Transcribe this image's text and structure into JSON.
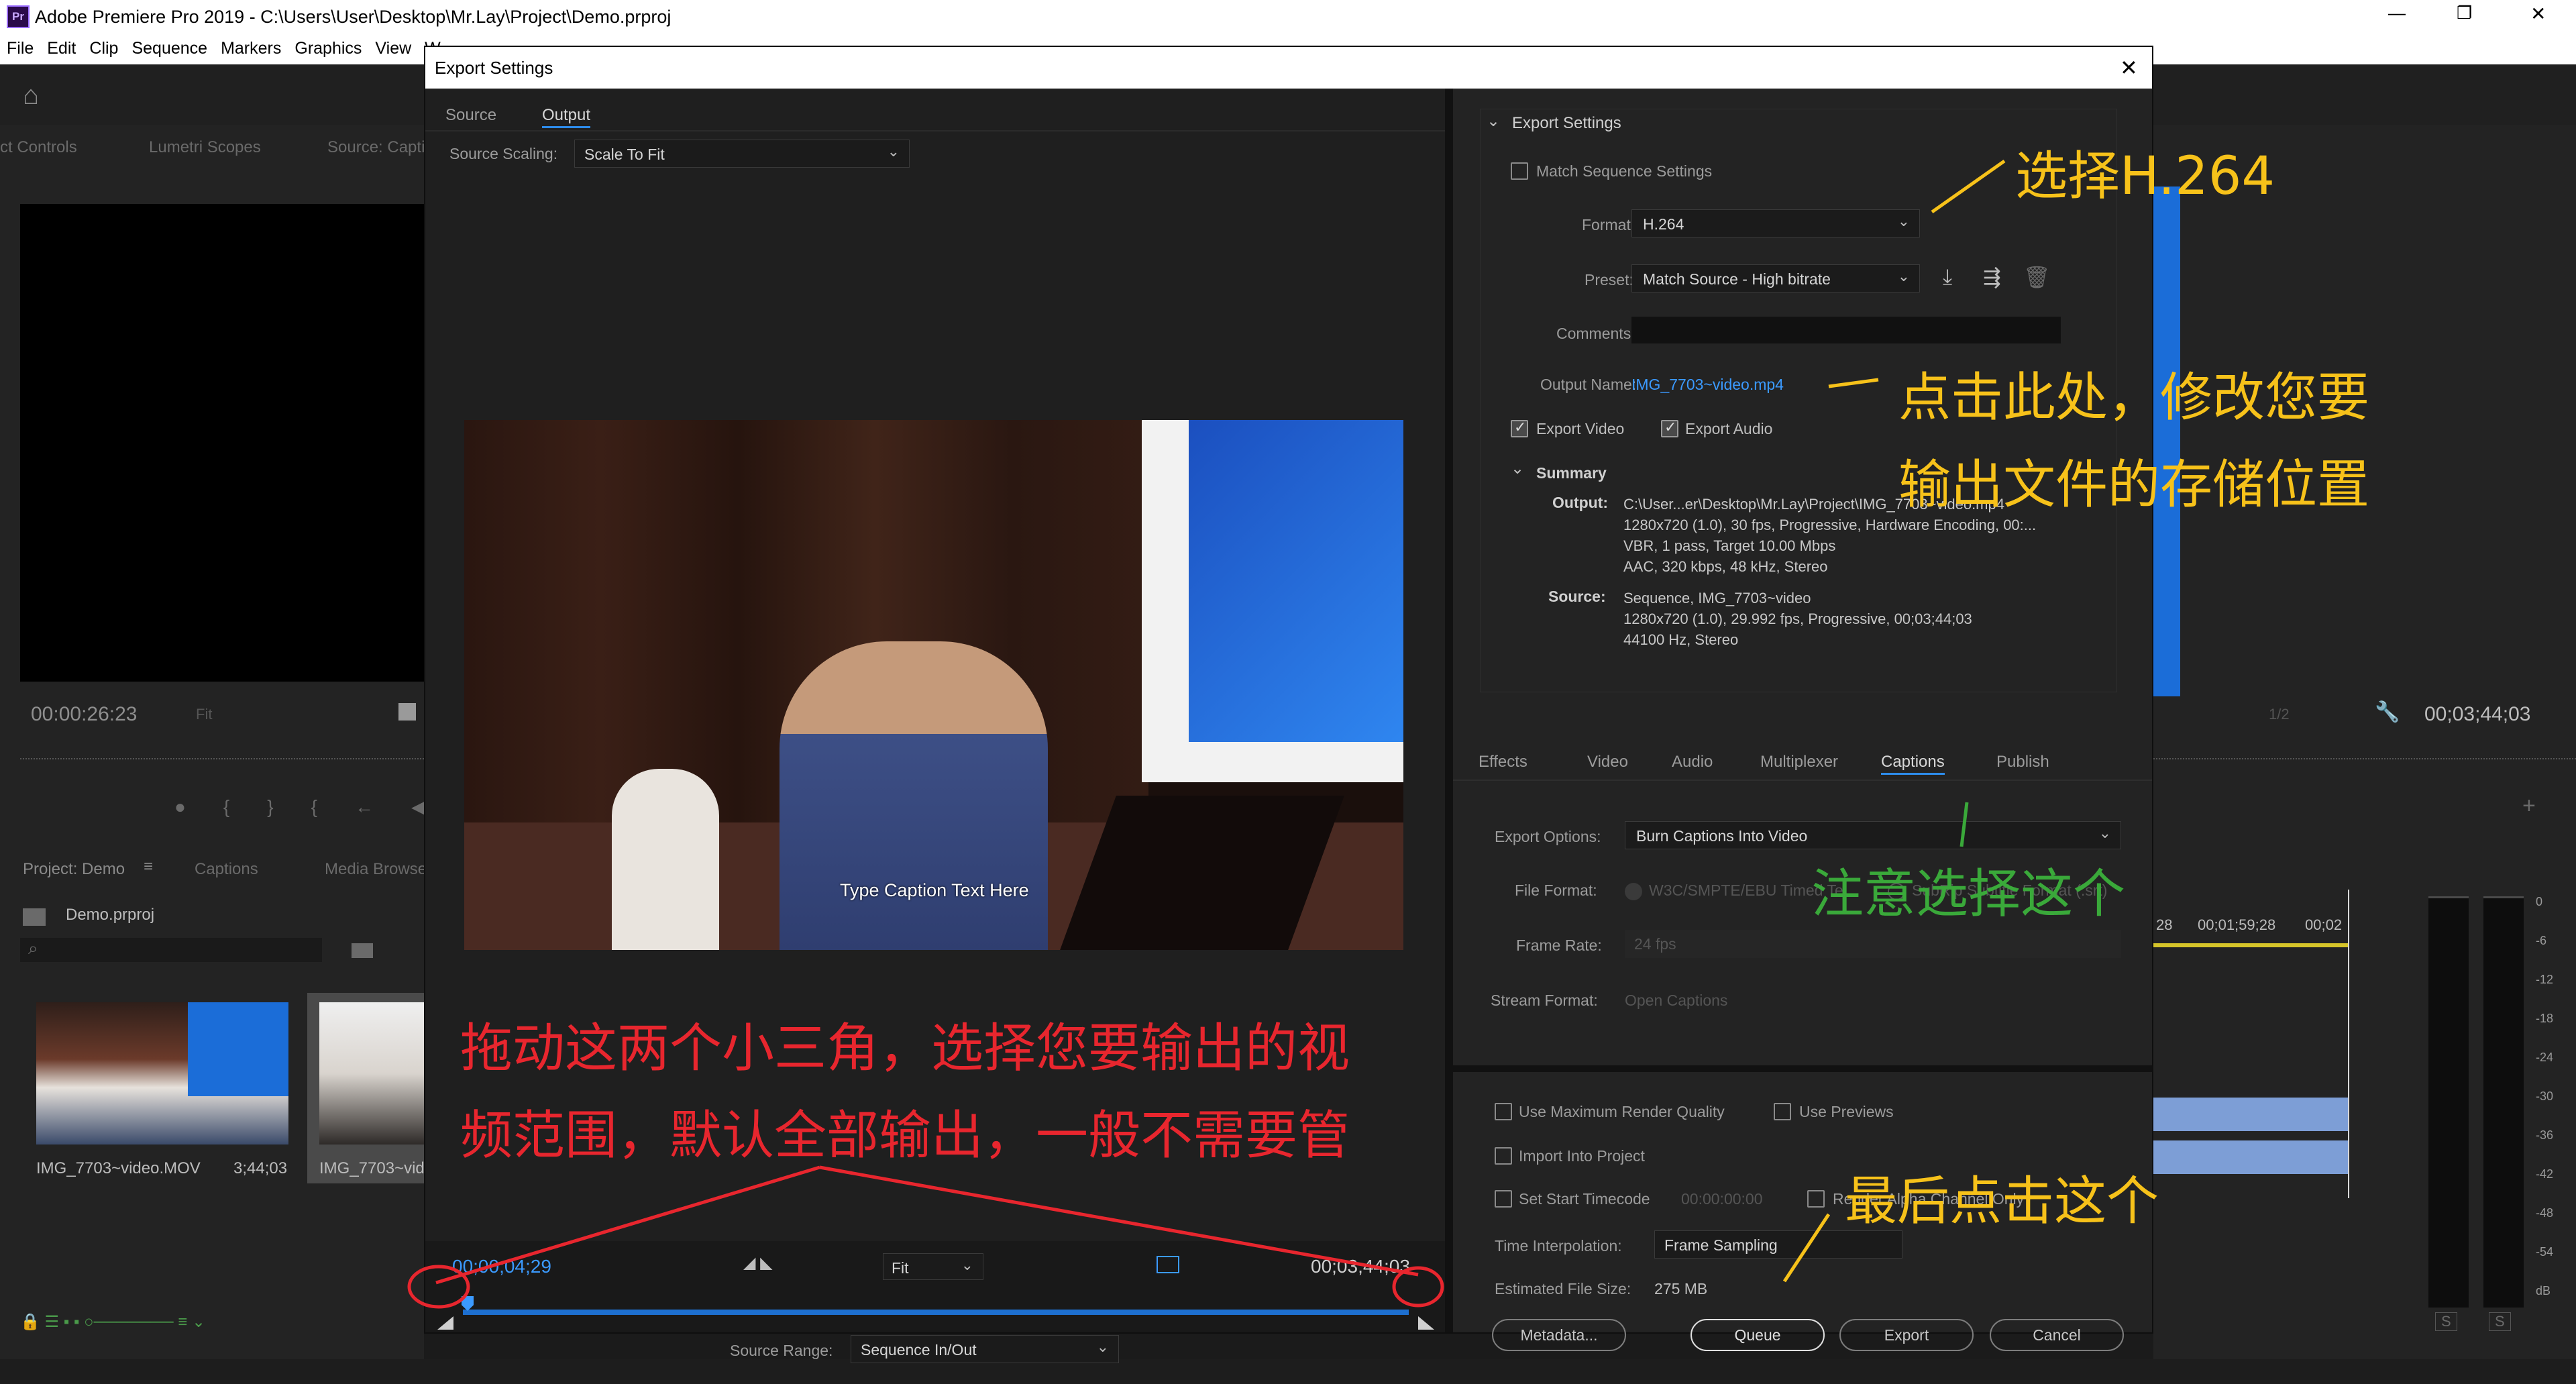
{
  "app": {
    "title": "Adobe Premiere Pro 2019 - C:\\Users\\User\\Desktop\\Mr.Lay\\Project\\Demo.prproj",
    "icon_label": "Pr",
    "window_controls": {
      "minimize": "—",
      "restore": "❐",
      "close": "✕"
    }
  },
  "menu": {
    "items": [
      "File",
      "Edit",
      "Clip",
      "Sequence",
      "Markers",
      "Graphics",
      "View",
      "W"
    ]
  },
  "left_panel": {
    "tabs": [
      "ct Controls",
      "Lumetri Scopes",
      "Source: Capti"
    ],
    "timecode": "00:00:26:23",
    "fit": "Fit",
    "transport": [
      "●",
      "{",
      "}",
      "{←",
      "◀|"
    ]
  },
  "project_panel": {
    "tabs": [
      "Project: Demo",
      "Captions",
      "Media Browse"
    ],
    "project_file": "Demo.prproj",
    "items": [
      {
        "name": "IMG_7703~video.MOV",
        "duration": "3;44;03"
      },
      {
        "name": "IMG_7703~vid",
        "duration": ""
      }
    ]
  },
  "right_side": {
    "fraction": "1/2",
    "timecode": "00;03;44;03",
    "timeline_times": [
      "28",
      "00;01;59;28",
      "00;02"
    ],
    "meter_scale": [
      "0",
      "-6",
      "-12",
      "-18",
      "-24",
      "-30",
      "-36",
      "-42",
      "-48",
      "-54",
      "dB"
    ],
    "solo": [
      "S",
      "S"
    ]
  },
  "dialog": {
    "title": "Export Settings",
    "close": "✕",
    "tabs": [
      "Source",
      "Output"
    ],
    "active_tab": "Output",
    "source_scaling_label": "Source Scaling:",
    "source_scaling_value": "Scale To Fit",
    "caption_preview": "Type Caption Text Here",
    "preview_timecode_in": "00;00;04;29",
    "preview_timecode_out": "00;03;44;03",
    "preview_fit": "Fit",
    "source_range_label": "Source Range:",
    "source_range_value": "Sequence In/Out",
    "export_settings": {
      "header": "Export Settings",
      "match_sequence": "Match Sequence Settings",
      "format_label": "Format:",
      "format_value": "H.264",
      "preset_label": "Preset:",
      "preset_value": "Match Source - High bitrate",
      "comments_label": "Comments:",
      "output_name_label": "Output Name:",
      "output_name_value": "IMG_7703~video.mp4",
      "export_video": "Export Video",
      "export_audio": "Export Audio",
      "summary_header": "Summary",
      "output_label": "Output:",
      "output_lines": [
        "C:\\User...er\\Desktop\\Mr.Lay\\Project\\IMG_7703~video.mp4",
        "1280x720 (1.0), 30 fps, Progressive, Hardware Encoding, 00:...",
        "VBR, 1 pass, Target 10.00 Mbps",
        "AAC, 320 kbps, 48 kHz, Stereo"
      ],
      "source_label": "Source:",
      "source_lines": [
        "Sequence, IMG_7703~video",
        "1280x720 (1.0), 29.992 fps, Progressive, 00;03;44;03",
        "44100 Hz, Stereo"
      ]
    },
    "settings_tabs": [
      "Effects",
      "Video",
      "Audio",
      "Multiplexer",
      "Captions",
      "Publish"
    ],
    "active_settings_tab": "Captions",
    "captions": {
      "export_options_label": "Export Options:",
      "export_options_value": "Burn Captions Into Video",
      "file_format_label": "File Format:",
      "file_format_opt1": "W3C/SMPTE/EBU Timed Te...",
      "file_format_opt2": "SubRip Subtitle Format (.srt)",
      "frame_rate_label": "Frame Rate:",
      "frame_rate_value": "24 fps",
      "stream_format_label": "Stream Format:",
      "stream_format_value": "Open Captions"
    },
    "bottom": {
      "use_max_render": "Use Maximum Render Quality",
      "use_previews": "Use Previews",
      "import_into_project": "Import Into Project",
      "set_start_timecode": "Set Start Timecode",
      "start_timecode_value": "00:00:00:00",
      "render_alpha": "Render Alpha Channel Only",
      "time_interp_label": "Time Interpolation:",
      "time_interp_value": "Frame Sampling",
      "est_size_label": "Estimated File Size:",
      "est_size_value": "275 MB",
      "metadata_btn": "Metadata...",
      "queue_btn": "Queue",
      "export_btn": "Export",
      "cancel_btn": "Cancel"
    }
  },
  "annotations": {
    "select_h264": "选择H.264",
    "click_here_line1": "点击此处，修改您要",
    "click_here_line2": "输出文件的存储位置",
    "note_select": "注意选择这个",
    "drag_line1": "拖动这两个小三角，选择您要输出的视",
    "drag_line2": "频范围，默认全部输出，一般不需要管",
    "finally_click": "最后点击这个"
  },
  "colors": {
    "accent_blue": "#2d8ceb",
    "annotation_red": "#e8262e",
    "annotation_yellow": "#f7c21a",
    "annotation_green": "#3aa93a"
  }
}
